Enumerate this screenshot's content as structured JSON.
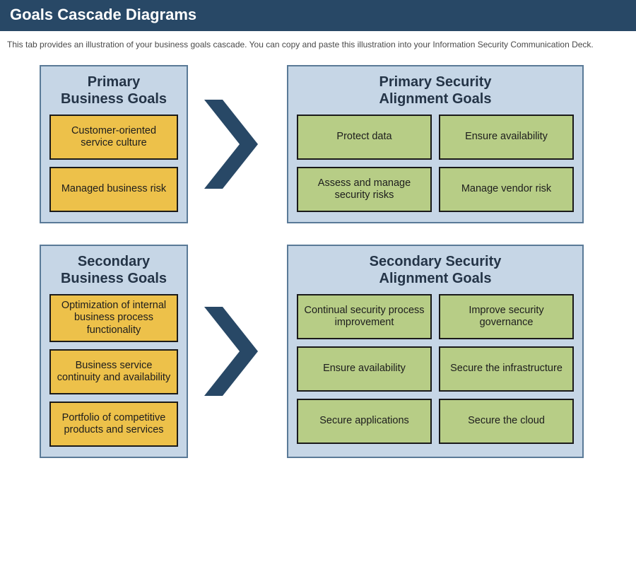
{
  "header": {
    "title": "Goals Cascade Diagrams"
  },
  "description": "This tab provides an illustration of your business goals cascade. You can copy and paste this illustration into your Information Security Communication Deck.",
  "rows": [
    {
      "left_title": "Primary\nBusiness Goals",
      "left_cards": [
        "Customer-oriented service culture",
        "Managed business risk"
      ],
      "right_title": "Primary Security\nAlignment Goals",
      "right_cards": [
        "Protect data",
        "Ensure availability",
        "Assess and manage security risks",
        "Manage vendor risk"
      ]
    },
    {
      "left_title": "Secondary\nBusiness Goals",
      "left_cards": [
        "Optimization of internal business process functionality",
        "Business service continuity and availability",
        "Portfolio of competitive products and services"
      ],
      "right_title": "Secondary Security\nAlignment Goals",
      "right_cards": [
        "Continual security process improvement",
        "Improve security governance",
        "Ensure availability",
        "Secure the infrastructure",
        "Secure applications",
        "Secure the cloud"
      ]
    }
  ],
  "colors": {
    "header_bg": "#284866",
    "panel_bg": "#c6d6e6",
    "gold": "#edc14a",
    "green": "#b7cd86"
  }
}
